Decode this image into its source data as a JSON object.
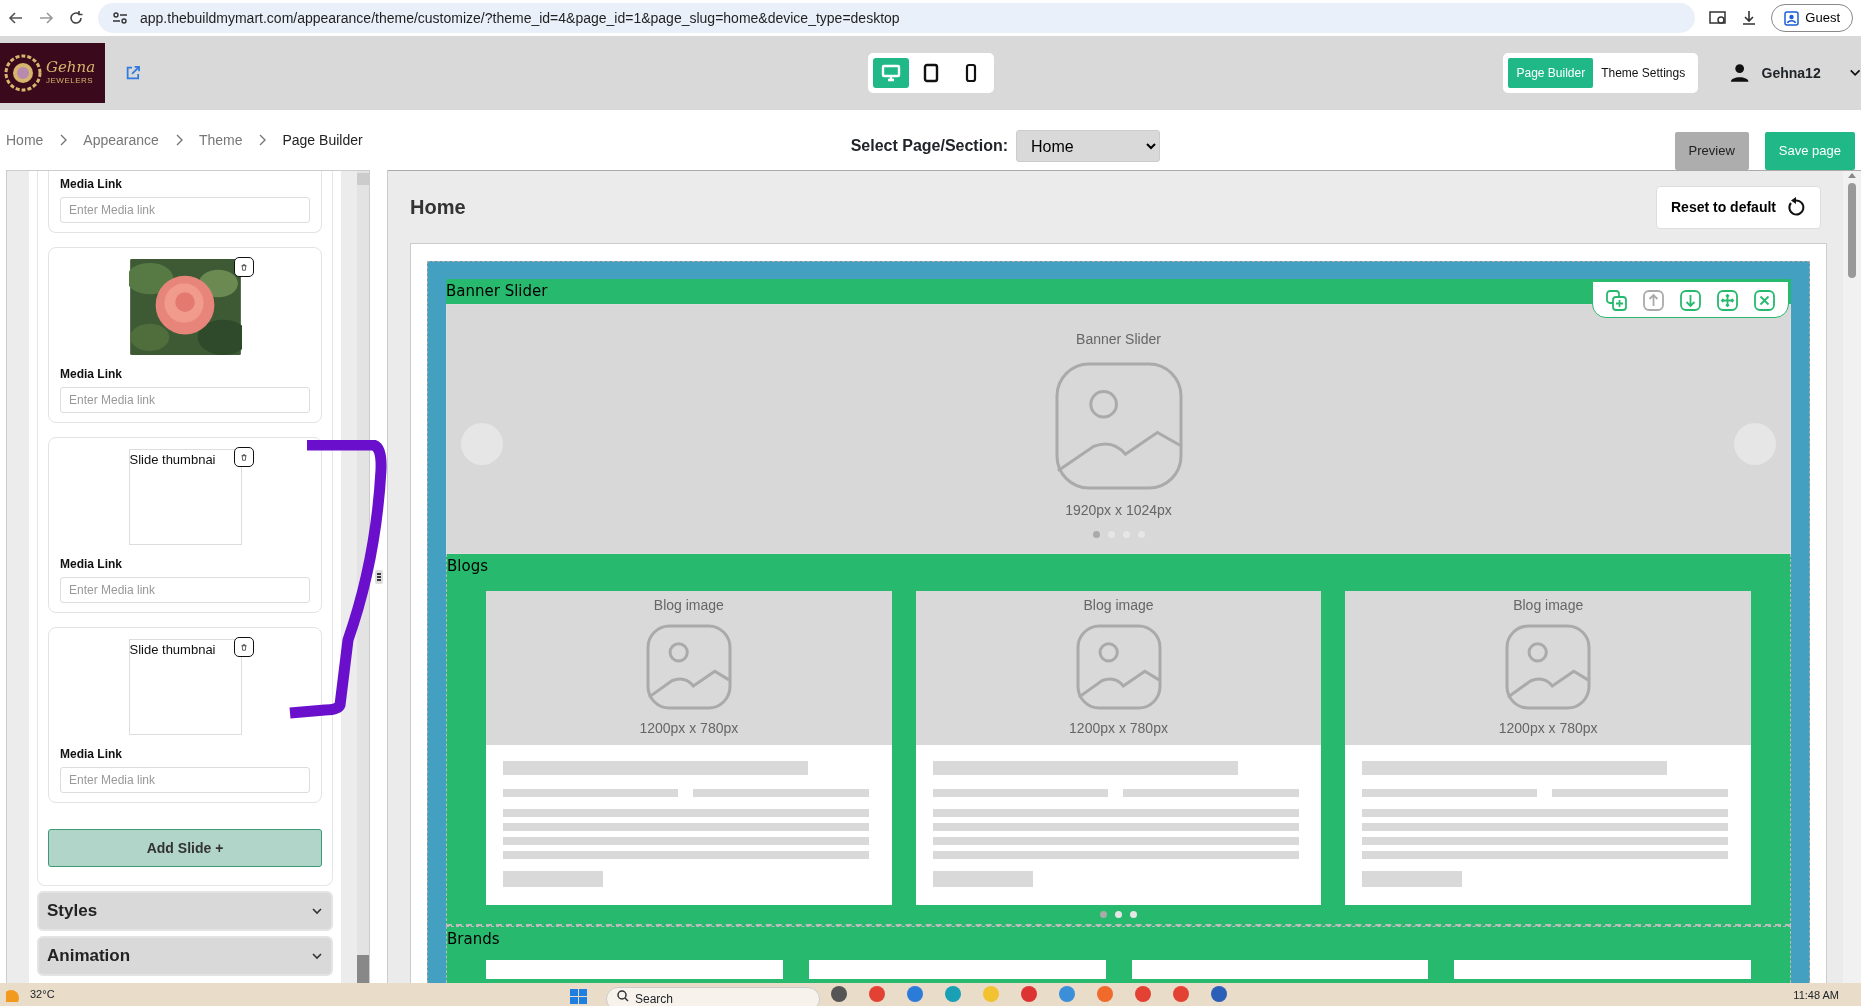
{
  "browser": {
    "url": "app.thebuildmymart.com/appearance/theme/customize/?theme_id=4&page_id=1&page_slug=home&device_type=desktop",
    "profile": "Guest"
  },
  "header": {
    "logo_name": "Gehna",
    "logo_tagline": "JEWELERS",
    "devices": [
      {
        "kind": "desktop",
        "selected": true
      },
      {
        "kind": "tablet",
        "selected": false
      },
      {
        "kind": "mobile",
        "selected": false
      }
    ],
    "modes": [
      {
        "label": "Page Builder",
        "selected": true
      },
      {
        "label": "Theme Settings",
        "selected": false
      }
    ],
    "user": "Gehna12"
  },
  "breadcrumb": [
    "Home",
    "Appearance",
    "Theme",
    "Page Builder"
  ],
  "page_select": {
    "label": "Select Page/Section:",
    "value": "Home"
  },
  "actions": [
    {
      "label": "Preview",
      "kind": "secondary"
    },
    {
      "label": "Save page",
      "kind": "primary"
    }
  ],
  "sidebar": {
    "slides": [
      {
        "kind": "link",
        "label": "Media Link",
        "placeholder": "Enter Media link"
      },
      {
        "kind": "picture",
        "label": "Media Link",
        "placeholder": "Enter Media link"
      },
      {
        "kind": "broken",
        "alt": "Slide thumbnai",
        "label": "Media Link",
        "placeholder": "Enter Media link"
      },
      {
        "kind": "broken",
        "alt": "Slide thumbnai",
        "label": "Media Link",
        "placeholder": "Enter Media link"
      }
    ],
    "add_button": "Add Slide +",
    "accordions": [
      {
        "label": "Styles",
        "expanded": false
      },
      {
        "label": "Animation",
        "expanded": false
      }
    ]
  },
  "canvas": {
    "title": "Home",
    "reset_button": "Reset to default",
    "toolbar": [
      {
        "kind": "duplicate",
        "disabled": false
      },
      {
        "kind": "up",
        "disabled": true
      },
      {
        "kind": "down",
        "disabled": false
      },
      {
        "kind": "move",
        "disabled": false
      },
      {
        "kind": "remove",
        "disabled": false
      }
    ],
    "sections": [
      {
        "kind": "banner",
        "label": "Banner Slider",
        "caption": "Banner Slider",
        "size": "1920px x 1024px",
        "dots": [
          {
            "selected": true
          },
          {
            "selected": false
          },
          {
            "selected": false
          },
          {
            "selected": false
          }
        ]
      },
      {
        "kind": "blogs",
        "label": "Blogs",
        "cards": [
          {
            "caption": "Blog image",
            "size": "1200px x 780px"
          },
          {
            "caption": "Blog image",
            "size": "1200px x 780px"
          },
          {
            "caption": "Blog image",
            "size": "1200px x 780px"
          }
        ],
        "dots": [
          {
            "selected": true
          },
          {
            "selected": false
          },
          {
            "selected": false
          }
        ]
      },
      {
        "kind": "brands",
        "label": "Brands",
        "cards": [
          {
            "kind": "empty"
          },
          {
            "kind": "empty"
          },
          {
            "kind": "empty"
          },
          {
            "kind": "empty"
          }
        ]
      }
    ]
  },
  "taskbar": {
    "weather": "32°C",
    "search_placeholder": "Search",
    "time": "11:48 AM"
  }
}
